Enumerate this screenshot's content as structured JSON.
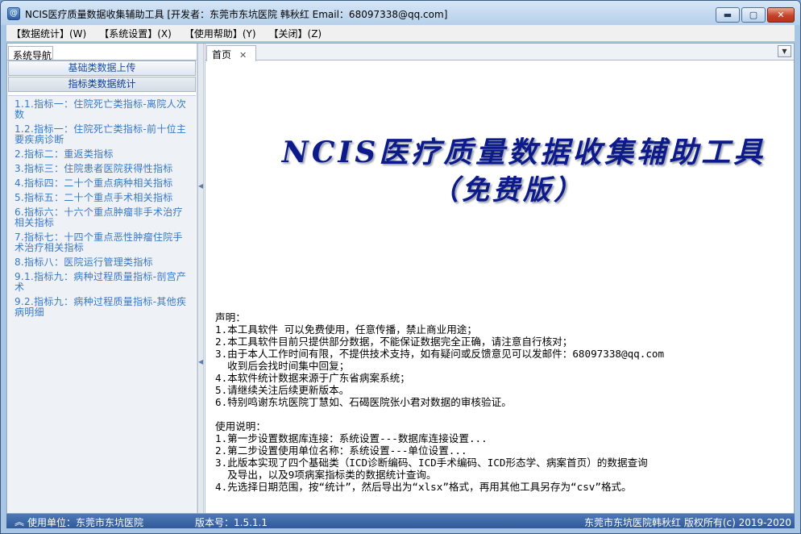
{
  "window": {
    "title": "NCIS医疗质量数据收集辅助工具  [开发者：东莞市东坑医院 韩秋红 Email：68097338@qq.com]",
    "icon": "app-icon",
    "buttons": {
      "minimize": "▬",
      "maximize": "▢",
      "close": "✕"
    }
  },
  "menu": [
    {
      "label": "【数据统计】(W)"
    },
    {
      "label": "【系统设置】(X)"
    },
    {
      "label": "【使用帮助】(Y)"
    },
    {
      "label": "【关闭】(Z)"
    }
  ],
  "sidebar": {
    "tab": "系统导航",
    "sections": [
      {
        "label": "基础类数据上传"
      },
      {
        "label": "指标类数据统计"
      }
    ],
    "items": [
      {
        "label": "1.1.指标一：住院死亡类指标-离院人次数"
      },
      {
        "label": "1.2.指标一：住院死亡类指标-前十位主要疾病诊断"
      },
      {
        "label": "2.指标二：重返类指标"
      },
      {
        "label": "3.指标三：住院患者医院获得性指标"
      },
      {
        "label": "4.指标四：二十个重点病种相关指标"
      },
      {
        "label": "5.指标五：二十个重点手术相关指标"
      },
      {
        "label": "6.指标六：十六个重点肿瘤非手术治疗相关指标"
      },
      {
        "label": "7.指标七：十四个重点恶性肿瘤住院手术治疗相关指标"
      },
      {
        "label": "8.指标八：医院运行管理类指标"
      },
      {
        "label": "9.1.指标九：病种过程质量指标-剖宫产术"
      },
      {
        "label": "9.2.指标九：病种过程质量指标-其他疾病明细"
      }
    ]
  },
  "main": {
    "tab_label": "首页",
    "tab_close": "✕",
    "dropdown": "▼",
    "banner_line1": "NCIS医疗质量数据收集辅助工具",
    "banner_line2": "（免费版）",
    "declaration_title": "声明：",
    "declarations": [
      "1.本工具软件 可以免费使用，任意传播，禁止商业用途；",
      "2.本工具软件目前只提供部分数据，不能保证数据完全正确，请注意自行核对；",
      "3.由于本人工作时间有限，不提供技术支持，如有疑问或反馈意见可以发邮件：68097338@qq.com",
      "  收到后会找时间集中回复；",
      "4.本软件统计数据来源于广东省病案系统；",
      "5.请继续关注后续更新版本。",
      "6.特别鸣谢东坑医院丁慧如、石碣医院张小君对数据的审核验证。"
    ],
    "usage_title": "使用说明：",
    "usage": [
      "1.第一步设置数据库连接：系统设置---数据库连接设置...",
      "2.第二步设置使用单位名称：系统设置---单位设置...",
      "3.此版本实现了四个基础类（ICD诊断编码、ICD手术编码、ICD形态学、病案首页）的数据查询",
      "  及导出，以及9项病案指标类的数据统计查询。",
      "4.先选择日期范围，按“统计”，然后导出为“xlsx”格式，再用其他工具另存为“csv”格式。"
    ]
  },
  "status": {
    "icon": "double-chevron-up-icon",
    "unit": "使用单位：东莞市东坑医院",
    "version": "版本号：1.5.1.1",
    "copyright": "东莞市东坑医院韩秋红  版权所有(c) 2019-2020"
  }
}
